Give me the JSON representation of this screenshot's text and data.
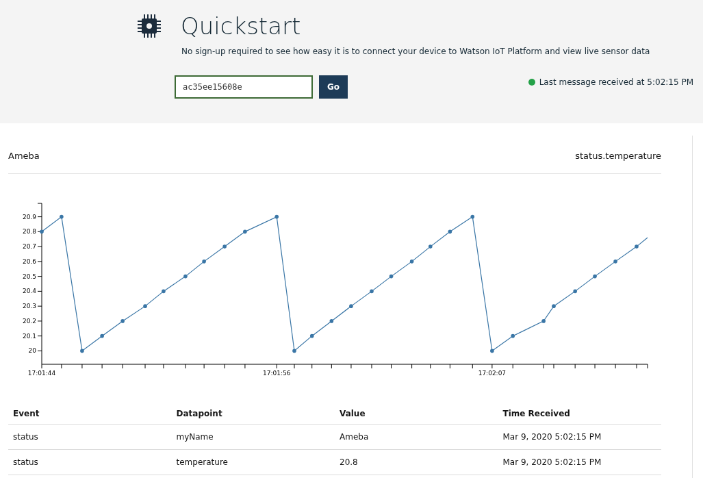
{
  "header": {
    "title": "Quickstart",
    "subtitle": "No sign-up required to see how easy it is to connect your device to Watson IoT Platform and view live sensor data",
    "device_id": {
      "value": "ac35ee15608e"
    },
    "go_button": "Go",
    "status": {
      "text": "Last message received at 5:02:15 PM",
      "color": "#24a148"
    }
  },
  "card": {
    "device": "Ameba",
    "datapoint": "status.temperature",
    "chart_data": {
      "type": "line",
      "x": [
        61304,
        61305.01,
        61306.06,
        61307.08,
        61308.13,
        61309.28,
        61310.22,
        61311.34,
        61312.29,
        61313.34,
        61314.38,
        61316,
        61316.9,
        61317.8,
        61318.8,
        61319.8,
        61320.85,
        61321.85,
        61322.9,
        61323.85,
        61324.85,
        61326,
        61327,
        61328.06,
        61329.63,
        61330.15,
        61331.24,
        61332.25,
        61333.3,
        61334.38,
        61334.94
      ],
      "series": [
        {
          "color": "#3a76a6",
          "values": [
            20.8,
            20.9,
            20,
            20.1,
            20.2,
            20.3,
            20.4,
            20.5,
            20.6,
            20.7,
            20.8,
            20.9,
            20,
            20.1,
            20.2,
            20.3,
            20.4,
            20.5,
            20.6,
            20.7,
            20.8,
            20.9,
            20,
            20.1,
            20.2,
            20.3,
            20.4,
            20.5,
            20.6,
            20.7,
            20.76
          ]
        }
      ],
      "xlim": [
        61304,
        61334.94
      ],
      "ylim": [
        19.91,
        20.99
      ],
      "xticks": [
        {
          "value": 61304,
          "label": "17:01:44"
        },
        {
          "value": 61316,
          "label": "17:01:56"
        },
        {
          "value": 61327,
          "label": "17:02:07"
        }
      ],
      "yticks": [
        {
          "value": 20,
          "label": "20"
        },
        20.1,
        20.2,
        20.3,
        20.4,
        20.5,
        20.6,
        20.7,
        20.8,
        20.9
      ]
    }
  },
  "table": {
    "columns": [
      "Event",
      "Datapoint",
      "Value",
      "Time Received"
    ],
    "rows": [
      [
        "status",
        "myName",
        "Ameba",
        "Mar 9, 2020 5:02:15 PM"
      ],
      [
        "status",
        "temperature",
        "20.8",
        "Mar 9, 2020 5:02:15 PM"
      ]
    ]
  }
}
